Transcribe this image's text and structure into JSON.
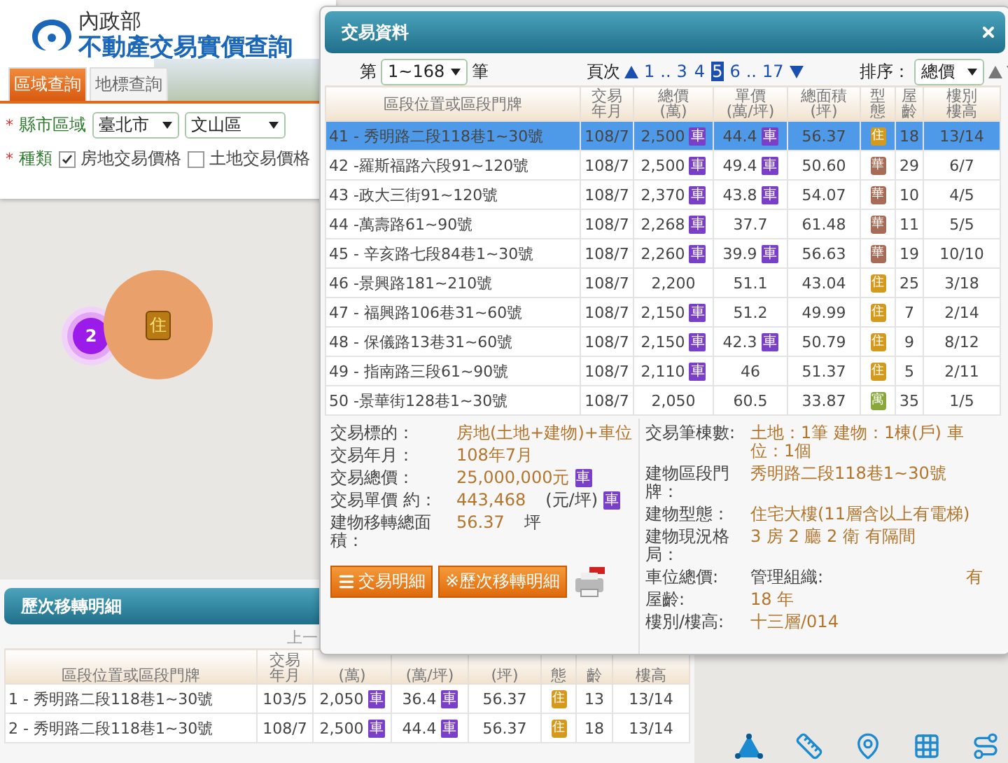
{
  "header": {
    "ministry": "內政部",
    "title": "不動產交易實價查詢"
  },
  "tabs": [
    {
      "label": "區域查詢",
      "selected": true
    },
    {
      "label": "地標查詢",
      "selected": false
    }
  ],
  "region": {
    "mark": "*",
    "label": "縣市區域",
    "city": "臺北市",
    "district": "文山區"
  },
  "category": {
    "mark": "*",
    "label": "種類",
    "options": [
      {
        "label": "房地交易價格",
        "checked": true
      },
      {
        "label": "土地交易價格",
        "checked": false
      }
    ]
  },
  "map": {
    "markers": [
      {
        "kind": "cluster",
        "text": "2"
      },
      {
        "kind": "house",
        "text": "住"
      }
    ]
  },
  "dialog": {
    "title": "交易資料",
    "pager": {
      "prefix": "第",
      "range": "1~168",
      "suffix": "筆",
      "page_label": "頁次",
      "pages": [
        {
          "kind": "page",
          "label": "1",
          "selected": false
        },
        {
          "kind": "gap",
          "label": ".."
        },
        {
          "kind": "page",
          "label": "3",
          "selected": false
        },
        {
          "kind": "page",
          "label": "4",
          "selected": false
        },
        {
          "kind": "page",
          "label": "5",
          "selected": true
        },
        {
          "kind": "page",
          "label": "6",
          "selected": false
        },
        {
          "kind": "gap",
          "label": ".."
        },
        {
          "kind": "page",
          "label": "17",
          "selected": false
        }
      ],
      "sort_label": "排序：",
      "sort": "總價"
    },
    "columns": [
      "區段位置或區段門牌",
      "交易年月",
      "總價\n(萬)",
      "單價\n(萬/坪)",
      "總面積\n(坪)",
      "型態",
      "屋齡",
      "樓別樓高"
    ],
    "rows": [
      {
        "no": "41",
        "address": "- 秀明路二段118巷1~30號",
        "date": "108/7",
        "price": "2,500",
        "price_badge": "車",
        "unit": "44.4",
        "unit_badge": "車",
        "area": "56.37",
        "type": "住",
        "color": "#d49a1e",
        "age": "18",
        "floor": "13/14",
        "selected": true
      },
      {
        "no": "42",
        "address": "-羅斯福路六段91~120號",
        "date": "108/7",
        "price": "2,500",
        "price_badge": "車",
        "unit": "49.4",
        "unit_badge": "車",
        "area": "50.60",
        "type": "華",
        "color": "#a86b55",
        "age": "29",
        "floor": "6/7",
        "selected": false
      },
      {
        "no": "43",
        "address": "-政大三街91~120號",
        "date": "108/7",
        "price": "2,370",
        "price_badge": "車",
        "unit": "43.8",
        "unit_badge": "車",
        "area": "54.07",
        "type": "華",
        "color": "#a86b55",
        "age": "10",
        "floor": "4/5",
        "selected": false
      },
      {
        "no": "44",
        "address": "-萬壽路61~90號",
        "date": "108/7",
        "price": "2,268",
        "price_badge": "車",
        "unit": "37.7",
        "area": "61.48",
        "type": "華",
        "color": "#a86b55",
        "age": "11",
        "floor": "5/5",
        "selected": false
      },
      {
        "no": "45",
        "address": "- 辛亥路七段84巷1~30號",
        "date": "108/7",
        "price": "2,260",
        "price_badge": "車",
        "unit": "39.9",
        "unit_badge": "車",
        "area": "56.63",
        "type": "華",
        "color": "#a86b55",
        "age": "19",
        "floor": "10/10",
        "selected": false
      },
      {
        "no": "46",
        "address": "-景興路181~210號",
        "date": "108/7",
        "price": "2,200",
        "unit": "51.1",
        "area": "43.04",
        "type": "住",
        "color": "#d49a1e",
        "age": "25",
        "floor": "3/18",
        "selected": false
      },
      {
        "no": "47",
        "address": "- 福興路106巷31~60號",
        "date": "108/7",
        "price": "2,150",
        "price_badge": "車",
        "unit": "51.2",
        "area": "49.99",
        "type": "住",
        "color": "#d49a1e",
        "age": "7",
        "floor": "2/14",
        "selected": false
      },
      {
        "no": "48",
        "address": "- 保儀路13巷31~60號",
        "date": "108/7",
        "price": "2,150",
        "price_badge": "車",
        "unit": "42.3",
        "unit_badge": "車",
        "area": "50.79",
        "type": "住",
        "color": "#d49a1e",
        "age": "9",
        "floor": "8/12",
        "selected": false
      },
      {
        "no": "49",
        "address": "- 指南路三段61~90號",
        "date": "108/7",
        "price": "2,110",
        "price_badge": "車",
        "unit": "46",
        "area": "51.37",
        "type": "住",
        "color": "#d49a1e",
        "age": "5",
        "floor": "2/11",
        "selected": false
      },
      {
        "no": "50",
        "address": "-景華街128巷1~30號",
        "date": "108/7",
        "price": "2,050",
        "unit": "60.5",
        "area": "33.87",
        "type": "寓",
        "color": "#8aa83a",
        "age": "35",
        "floor": "1/5",
        "selected": false
      }
    ],
    "detail": {
      "left": [
        {
          "label": "交易標的：",
          "value": "房地(土地+建物)+車位"
        },
        {
          "label": "交易年月：",
          "value": "108年7月"
        },
        {
          "label": "交易總價：",
          "value": "25,000,000元",
          "badge": "車"
        },
        {
          "label": "交易單價 約：",
          "value": "443,468",
          "unit": "(元/坪)",
          "badge": "車"
        },
        {
          "label": "建物移轉總面積：",
          "value": "56.37",
          "unit": "坪"
        }
      ],
      "buttons": [
        {
          "kind": "list",
          "label": "交易明細"
        },
        {
          "kind": "plain",
          "label": "※歷次移轉明細"
        }
      ],
      "right": [
        {
          "label": "交易筆棟數:",
          "value": "土地：1筆 建物：1棟(戶) 車位：1個"
        },
        {
          "label": "建物區段門牌：",
          "value": "秀明路二段118巷1~30號"
        },
        {
          "label": "建物型態：",
          "value": "住宅大樓(11層含以上有電梯)"
        },
        {
          "label": "建物現況格局：",
          "value": "3 房 2 廳 2 衛 有隔間"
        },
        {
          "label": "車位總價:",
          "extra_label": "管理組織:",
          "extra_value": "有"
        },
        {
          "label": "屋齡:",
          "value": "18 年"
        },
        {
          "label": "樓別/樓高:",
          "value": "十三層/014"
        }
      ]
    }
  },
  "history": {
    "title": "歷次移轉明細",
    "pager_fragment": "上一",
    "columns": [
      "區段位置或區段門牌",
      "交易年月",
      "(萬)",
      "(萬/坪)",
      "(坪)",
      "態",
      "齡",
      "樓高"
    ],
    "rows": [
      {
        "no": "1",
        "address": "- 秀明路二段118巷1~30號",
        "date": "103/5",
        "price": "2,050",
        "price_badge": "車",
        "unit": "36.4",
        "unit_badge": "車",
        "area": "56.37",
        "type": "住",
        "color": "#d49a1e",
        "age": "13",
        "floor": "13/14"
      },
      {
        "no": "2",
        "address": "- 秀明路二段118巷1~30號",
        "date": "108/7",
        "price": "2,500",
        "price_badge": "車",
        "unit": "44.4",
        "unit_badge": "車",
        "area": "56.37",
        "type": "住",
        "color": "#d49a1e",
        "age": "18",
        "floor": "13/14"
      }
    ]
  }
}
